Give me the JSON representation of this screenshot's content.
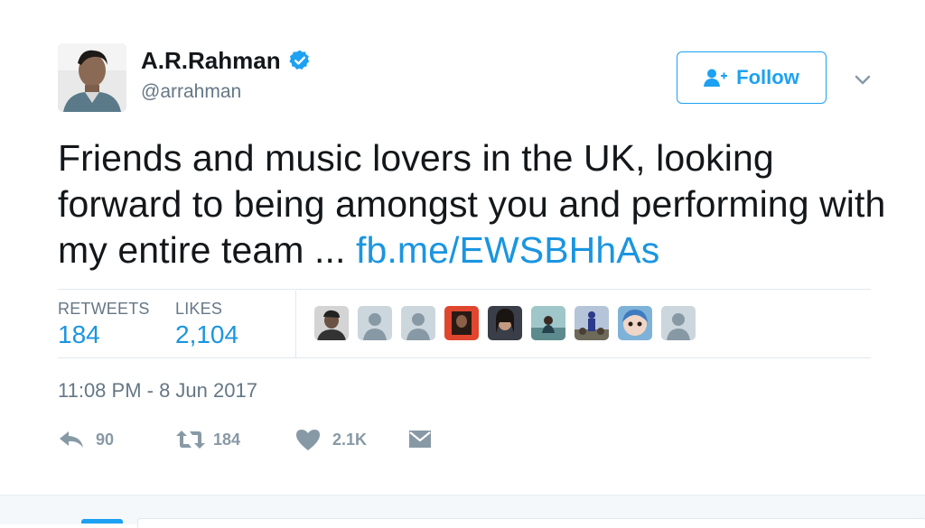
{
  "user": {
    "display_name": "A.R.Rahman",
    "handle": "@arrahman",
    "verified": true
  },
  "follow_button": {
    "label": "Follow"
  },
  "tweet": {
    "text": "Friends and music lovers in the UK, looking forward to being amongst you and performing with my entire team ...",
    "link": "fb.me/EWSBHhAs"
  },
  "stats": {
    "retweets_label": "RETWEETS",
    "retweets_value": "184",
    "likes_label": "LIKES",
    "likes_value": "2,104"
  },
  "timestamp": "11:08 PM - 8 Jun 2017",
  "actions": {
    "reply_count": "90",
    "retweet_count": "184",
    "like_count": "2.1K"
  },
  "colors": {
    "accent": "#1da1f2",
    "link": "#1b95e0",
    "muted": "#657786"
  },
  "icons": [
    "verified-badge-icon",
    "follow-user-plus-icon",
    "chevron-down-icon",
    "reply-icon",
    "retweet-icon",
    "heart-icon",
    "direct-message-icon"
  ]
}
